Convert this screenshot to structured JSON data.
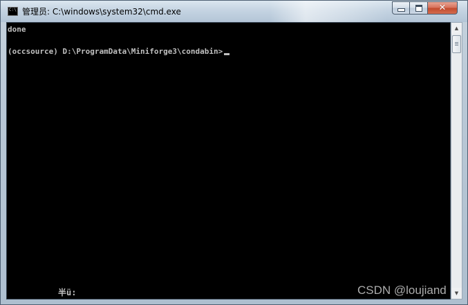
{
  "window": {
    "title": "管理员: C:\\windows\\system32\\cmd.exe",
    "icon_name": "cmd-icon",
    "icon_text": "C:\\",
    "buttons": {
      "minimize": "minimize-icon",
      "maximize": "maximize-icon",
      "close": "close-icon",
      "close_glyph": "✕"
    }
  },
  "console": {
    "lines": [
      "done",
      "(occsource) D:\\ProgramData\\Miniforge3\\condabin>"
    ],
    "ime_status": "半ü:",
    "text_color": "#c0c0c0",
    "background": "#000000"
  },
  "scrollbar": {
    "up_arrow": "▲",
    "down_arrow": "▼"
  },
  "watermark": "CSDN @loujiand"
}
